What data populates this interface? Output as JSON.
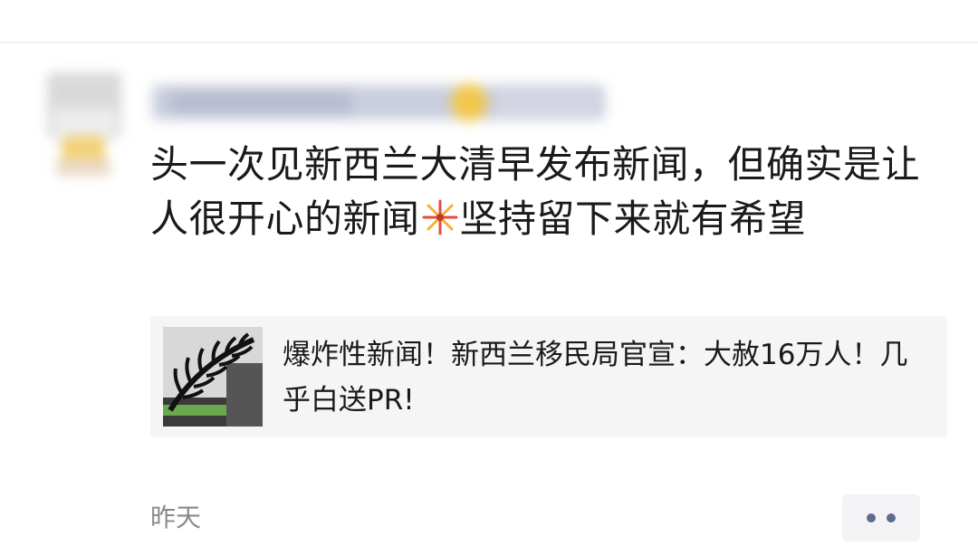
{
  "post": {
    "author_name_blurred": true,
    "text_part1": "头一次见新西兰大清早发布新闻，但确实是让人很开心的新闻",
    "text_emoji_icon": "firework-icon",
    "text_part2": "坚持留下来就有希望",
    "timestamp": "昨天",
    "more_icon": "more-dots-icon"
  },
  "link_card": {
    "thumbnail_icon": "silver-fern-icon",
    "title": "爆炸性新闻！新西兰移民局官宣：大赦16万人！几乎白送PR!"
  },
  "colors": {
    "text": "#1a1a1a",
    "secondary_text": "#8a8a8a",
    "card_background": "#f5f5f5",
    "link_blue": "#5d6c8e"
  }
}
